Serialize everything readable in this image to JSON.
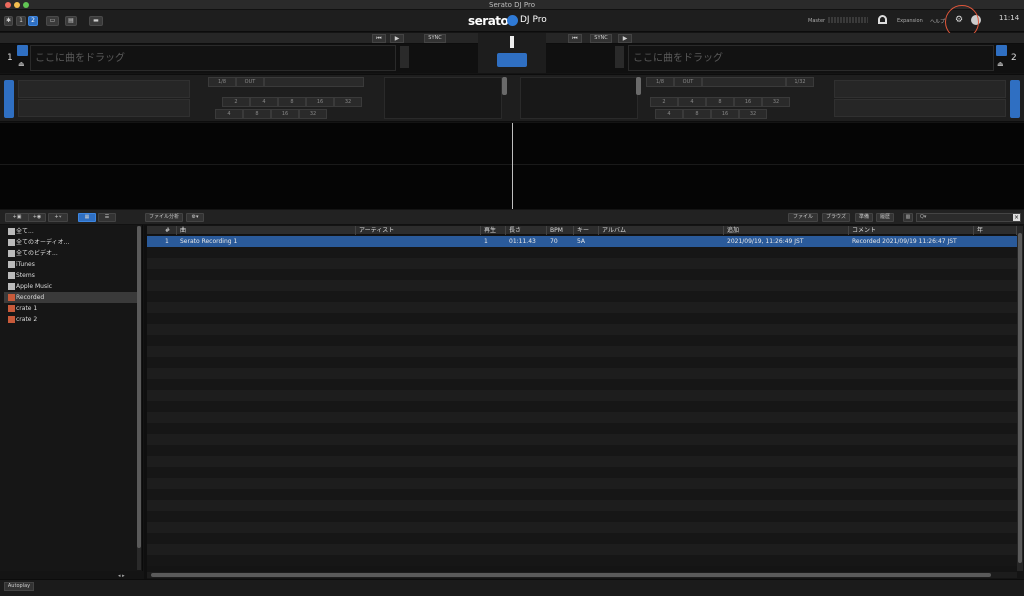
{
  "window": {
    "title": "Serato DJ Pro"
  },
  "toolbar": {
    "layout_buttons": [
      "1",
      "2"
    ],
    "brand": "serato",
    "product": "DJ Pro",
    "master_label": "Master",
    "expansion_label": "Expansion",
    "help_label": "ヘルプ",
    "clock": "11:14"
  },
  "deck1": {
    "number": "1",
    "drop_text": "ここに曲をドラッグ",
    "sync": "SYNC"
  },
  "deck2": {
    "number": "2",
    "drop_text": "ここに曲をドラッグ",
    "sync": "SYNC"
  },
  "loop_rows": {
    "row1": [
      "1/8",
      "OUT",
      "",
      "",
      "",
      "1/32"
    ],
    "row2": [
      "2",
      "4",
      "8",
      "16",
      "32",
      "",
      ""
    ],
    "row3": [
      "4",
      "8",
      "16",
      "32",
      "",
      ""
    ]
  },
  "library_toolbar": {
    "analyze": "ファイル分析",
    "files": "ファイル",
    "browse": "ブラウズ",
    "prepare": "準備",
    "history": "履歴",
    "search_placeholder": "Q▾"
  },
  "sidebar": {
    "items": [
      {
        "label": "全て...",
        "icon": "all-icon"
      },
      {
        "label": "全てのオーディオ...",
        "icon": "speaker-icon"
      },
      {
        "label": "全てのビデオ...",
        "icon": "video-icon"
      },
      {
        "label": "iTunes",
        "icon": "itunes-icon"
      },
      {
        "label": "Stems",
        "icon": "stems-icon"
      },
      {
        "label": "Apple Music",
        "icon": "apple-music-icon"
      },
      {
        "label": "Recorded",
        "icon": "crate-icon",
        "selected": true
      },
      {
        "label": "crate 1",
        "icon": "crate-icon"
      },
      {
        "label": "crate 2",
        "icon": "crate-icon"
      }
    ]
  },
  "table": {
    "columns": [
      "#",
      "曲",
      "アーティスト",
      "再生",
      "長さ",
      "BPM",
      "キー",
      "アルバム",
      "追加",
      "コメント",
      "年"
    ],
    "rows": [
      [
        "1",
        "Serato Recording 1",
        "",
        "1",
        "01:11.43",
        "70",
        "5A",
        "",
        "2021/09/19, 11:26:49 JST",
        "Recorded 2021/09/19 11:26:47 JST",
        ""
      ]
    ]
  },
  "bottom": {
    "autoplay": "Autoplay"
  },
  "colors": {
    "accent": "#2f6fc2",
    "highlight_ring": "#e0563a",
    "selected_row": "#2a5a9a"
  }
}
